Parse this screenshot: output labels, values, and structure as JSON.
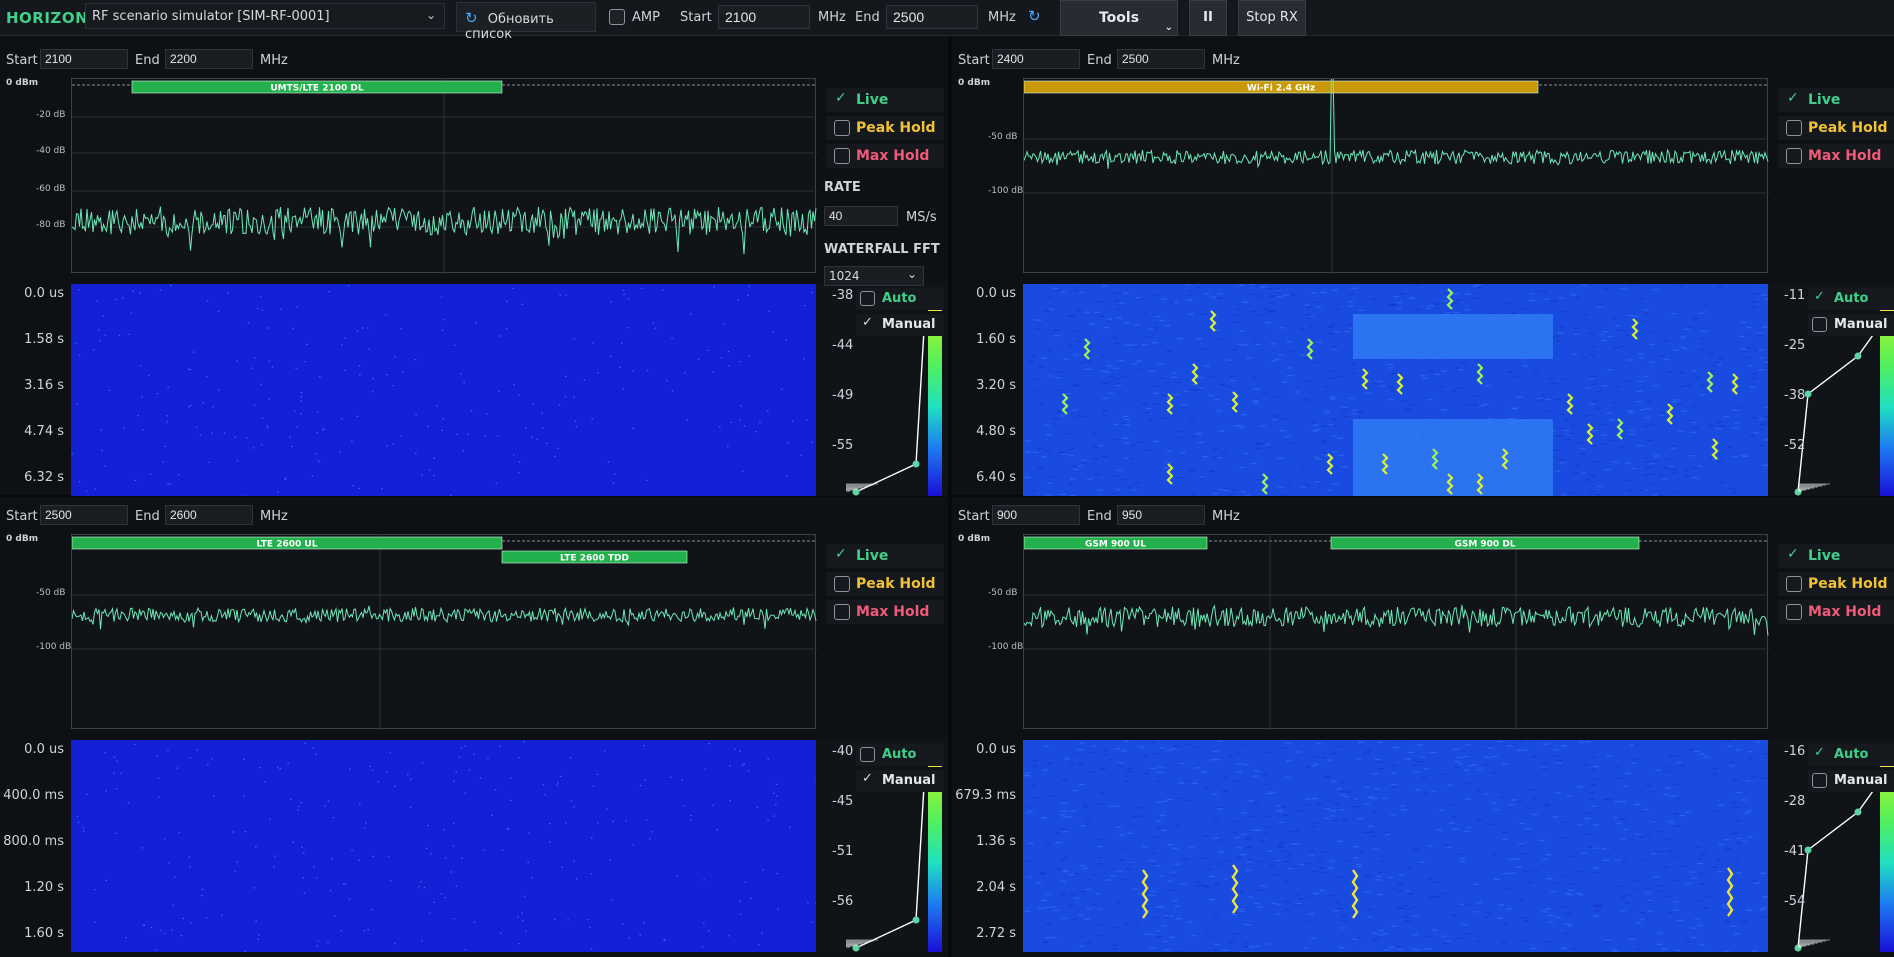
{
  "app": {
    "brand": "HORIZON",
    "source_combo": "RF scenario simulator [SIM-RF-0001]",
    "refresh_label": "Обновить список",
    "amp_label": "AMP",
    "start_label": "Start",
    "start_value": "2100",
    "mhz1": "MHz",
    "end_label": "End",
    "end_value": "2500",
    "mhz2": "MHz",
    "tools_label": "Tools",
    "pause_label": "II",
    "stop_label": "Stop RX"
  },
  "common": {
    "start": "Start",
    "end": "End",
    "mhz": "MHz",
    "live": "Live",
    "peak_hold": "Peak Hold",
    "max_hold": "Max Hold",
    "auto": "Auto",
    "manual": "Manual",
    "rate_title": "RATE",
    "rate_value": "40",
    "rate_unit": "MS/s",
    "wf_fft_title": "WATERFALL FFT",
    "wf_fft_value": "1024"
  },
  "panels": [
    {
      "start": "2100",
      "end": "2200",
      "y_labels": [
        "0 dBm",
        "-20 dB",
        "-40 dB",
        "-60 dB",
        "-80 dB"
      ],
      "bands": [
        {
          "name": "UMTS/LTE 2100 DL",
          "color": "#22b14c"
        }
      ],
      "time_labels": [
        "0.0 us",
        "1.58 s",
        "3.16 s",
        "4.74 s",
        "6.32 s"
      ],
      "cmap_labels": [
        "-38",
        "-44",
        "-49",
        "-55"
      ],
      "auto": false,
      "manual": true
    },
    {
      "start": "2400",
      "end": "2500",
      "y_labels": [
        "0 dBm",
        "-50 dB",
        "-100 dB"
      ],
      "bands": [
        {
          "name": "Wi-Fi 2.4 GHz",
          "color": "#c99a06"
        }
      ],
      "time_labels": [
        "0.0 us",
        "1.60 s",
        "3.20 s",
        "4.80 s",
        "6.40 s"
      ],
      "cmap_labels": [
        "-11",
        "-25",
        "-38",
        "-52"
      ],
      "auto": true,
      "manual": false
    },
    {
      "start": "2500",
      "end": "2600",
      "y_labels": [
        "0 dBm",
        "-50 dB",
        "-100 dB"
      ],
      "bands": [
        {
          "name": "LTE 2600 UL",
          "color": "#22b14c"
        },
        {
          "name": "LTE 2600 TDD",
          "color": "#22b14c"
        }
      ],
      "time_labels": [
        "0.0 us",
        "400.0 ms",
        "800.0 ms",
        "1.20 s",
        "1.60 s"
      ],
      "cmap_labels": [
        "-40",
        "-45",
        "-51",
        "-56"
      ],
      "auto": false,
      "manual": true
    },
    {
      "start": "900",
      "end": "950",
      "y_labels": [
        "0 dBm",
        "-50 dB",
        "-100 dB"
      ],
      "bands": [
        {
          "name": "GSM 900 UL",
          "color": "#22b14c"
        },
        {
          "name": "GSM 900 DL",
          "color": "#22b14c"
        }
      ],
      "time_labels": [
        "0.0 us",
        "679.3 ms",
        "1.36 s",
        "2.04 s",
        "2.72 s"
      ],
      "cmap_labels": [
        "-16",
        "-28",
        "-41",
        "-54"
      ],
      "auto": true,
      "manual": false
    }
  ],
  "colors": {
    "trace": "#6ee7b7",
    "accent_green": "#3fd08a",
    "peak_yellow": "#f1c232",
    "max_red": "#f05a78",
    "waterfall_deep": "#1320d6",
    "waterfall_mid": "#1f59e0"
  }
}
